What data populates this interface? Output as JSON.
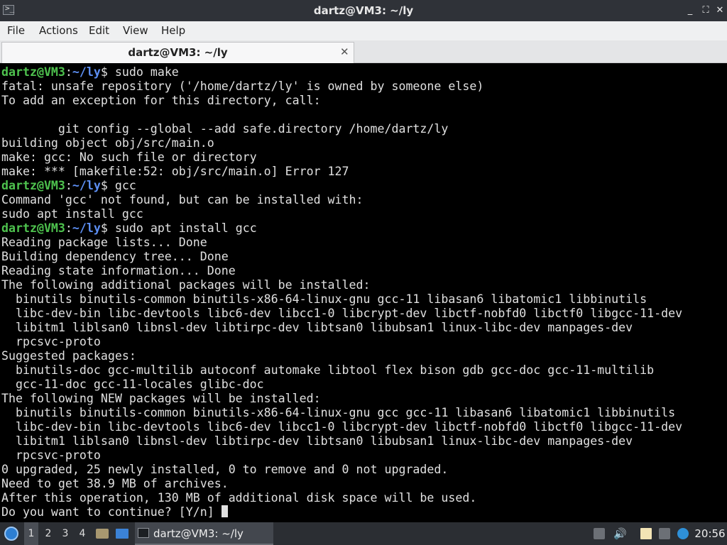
{
  "window": {
    "title": "dartz@VM3: ~/ly",
    "icon": "terminal-icon",
    "controls": {
      "minimize": "_",
      "maximize": "⛶",
      "close": "✕"
    }
  },
  "menubar": {
    "items": [
      "File",
      "Actions",
      "Edit",
      "View",
      "Help"
    ]
  },
  "tabs": [
    {
      "label": "dartz@VM3: ~/ly",
      "close": "✕"
    }
  ],
  "terminal": {
    "prompt": {
      "user_host": "dartz@VM3",
      "colon": ":",
      "path": "~/ly",
      "symbol": "$"
    },
    "lines": [
      {
        "type": "prompt",
        "command": " sudo make"
      },
      {
        "type": "output",
        "text": "fatal: unsafe repository ('/home/dartz/ly' is owned by someone else)"
      },
      {
        "type": "output",
        "text": "To add an exception for this directory, call:"
      },
      {
        "type": "output",
        "text": ""
      },
      {
        "type": "output",
        "text": "        git config --global --add safe.directory /home/dartz/ly"
      },
      {
        "type": "output",
        "text": "building object obj/src/main.o"
      },
      {
        "type": "output",
        "text": "make: gcc: No such file or directory"
      },
      {
        "type": "output",
        "text": "make: *** [makefile:52: obj/src/main.o] Error 127"
      },
      {
        "type": "prompt",
        "command": " gcc"
      },
      {
        "type": "output",
        "text": "Command 'gcc' not found, but can be installed with:"
      },
      {
        "type": "output",
        "text": "sudo apt install gcc"
      },
      {
        "type": "prompt",
        "command": " sudo apt install gcc"
      },
      {
        "type": "output",
        "text": "Reading package lists... Done"
      },
      {
        "type": "output",
        "text": "Building dependency tree... Done"
      },
      {
        "type": "output",
        "text": "Reading state information... Done"
      },
      {
        "type": "output",
        "text": "The following additional packages will be installed:"
      },
      {
        "type": "output",
        "text": "  binutils binutils-common binutils-x86-64-linux-gnu gcc-11 libasan6 libatomic1 libbinutils"
      },
      {
        "type": "output",
        "text": "  libc-dev-bin libc-devtools libc6-dev libcc1-0 libcrypt-dev libctf-nobfd0 libctf0 libgcc-11-dev"
      },
      {
        "type": "output",
        "text": "  libitm1 liblsan0 libnsl-dev libtirpc-dev libtsan0 libubsan1 linux-libc-dev manpages-dev"
      },
      {
        "type": "output",
        "text": "  rpcsvc-proto"
      },
      {
        "type": "output",
        "text": "Suggested packages:"
      },
      {
        "type": "output",
        "text": "  binutils-doc gcc-multilib autoconf automake libtool flex bison gdb gcc-doc gcc-11-multilib"
      },
      {
        "type": "output",
        "text": "  gcc-11-doc gcc-11-locales glibc-doc"
      },
      {
        "type": "output",
        "text": "The following NEW packages will be installed:"
      },
      {
        "type": "output",
        "text": "  binutils binutils-common binutils-x86-64-linux-gnu gcc gcc-11 libasan6 libatomic1 libbinutils"
      },
      {
        "type": "output",
        "text": "  libc-dev-bin libc-devtools libc6-dev libcc1-0 libcrypt-dev libctf-nobfd0 libctf0 libgcc-11-dev"
      },
      {
        "type": "output",
        "text": "  libitm1 liblsan0 libnsl-dev libtirpc-dev libtsan0 libubsan1 linux-libc-dev manpages-dev"
      },
      {
        "type": "output",
        "text": "  rpcsvc-proto"
      },
      {
        "type": "output",
        "text": "0 upgraded, 25 newly installed, 0 to remove and 0 not upgraded."
      },
      {
        "type": "output",
        "text": "Need to get 38.9 MB of archives."
      },
      {
        "type": "output",
        "text": "After this operation, 130 MB of additional disk space will be used."
      },
      {
        "type": "input",
        "text": "Do you want to continue? [Y/n] "
      }
    ]
  },
  "taskbar": {
    "start_icon": "start-menu-icon",
    "workspaces": [
      "1",
      "2",
      "3",
      "4"
    ],
    "active_workspace": "1",
    "launchers": [
      "file-manager-icon",
      "show-desktop-icon"
    ],
    "task": {
      "label": "dartz@VM3: ~/ly",
      "icon": "terminal-icon"
    },
    "tray": [
      "update-notifier-icon",
      "volume-icon",
      "clipboard-icon",
      "network-icon",
      "help-icon"
    ],
    "clock": "20:56"
  },
  "colors": {
    "prompt_user": "#4ec24e",
    "prompt_path": "#5c8ef2",
    "terminal_bg": "#000000",
    "terminal_fg": "#e0e0e0",
    "titlebar_bg": "#2f3238",
    "taskbar_bg": "#2b2e33"
  }
}
